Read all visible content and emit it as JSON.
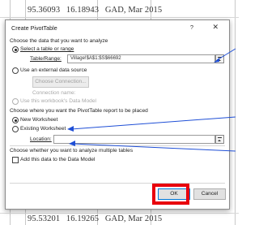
{
  "background_rows": [
    {
      "a": "95.36093",
      "b": "16.18943",
      "c": "GAD, Mar 2015"
    },
    {
      "a": "95.53201",
      "b": "16.19265",
      "c": "GAD, Mar 2015"
    }
  ],
  "dialog": {
    "title": "Create PivotTable",
    "help": "?",
    "close": "✕",
    "section1": "Choose the data that you want to analyze",
    "opt_select_table": "Select a table or range",
    "table_range_label": "Table/Range:",
    "table_range_value": "Village!$A$1:$S$66692",
    "opt_external": "Use an external data source",
    "choose_connection": "Choose Connection...",
    "connection_name": "Connection name:",
    "opt_data_model": "Use this workbook's Data Model",
    "section2": "Choose where you want the PivotTable report to be placed",
    "opt_new_sheet": "New Worksheet",
    "opt_existing_sheet": "Existing Worksheet",
    "location_label": "Location:",
    "location_value": "",
    "section3": "Choose whether you want to analyze multiple tables",
    "add_to_model": "Add this data to the Data Model",
    "ok": "OK",
    "cancel": "Cancel"
  },
  "accent": {
    "annotation": "#1f4fd6",
    "highlight": "#e8000d"
  }
}
